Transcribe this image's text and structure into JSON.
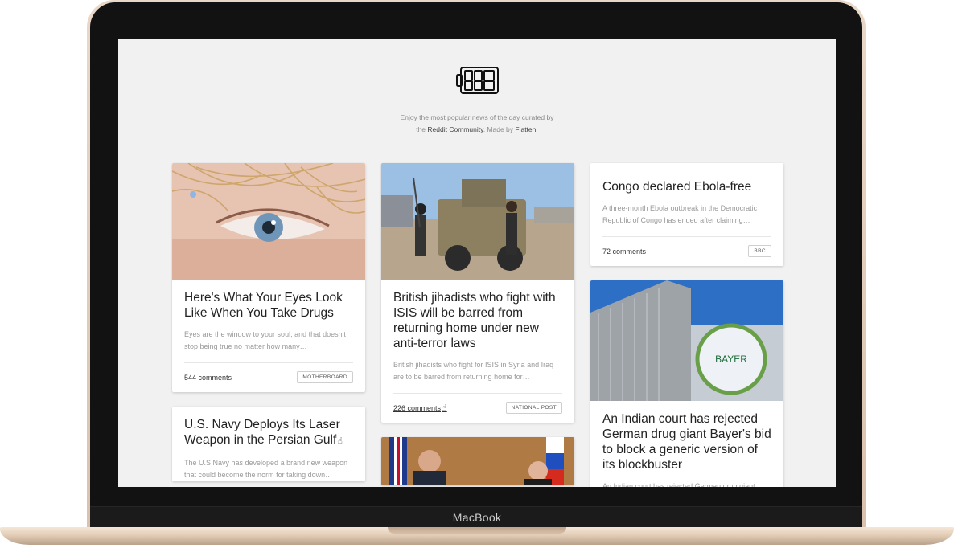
{
  "device": {
    "label": "MacBook"
  },
  "site": {
    "logo_icon": "tile-grid-logo-icon",
    "tagline": {
      "line1": "Enjoy the most popular news of the day curated by",
      "pre": "the ",
      "community": "Reddit Community",
      "mid": ". Made by ",
      "maker": "Flatten",
      "post": "."
    }
  },
  "cards": {
    "eyes": {
      "title": "Here's What Your Eyes Look Like When You Take Drugs",
      "excerpt": "Eyes are the window to your soul, and that doesn't stop being true no matter how many…",
      "comments": "544 comments",
      "source": "MOTHERBOARD"
    },
    "navy": {
      "title": "U.S. Navy Deploys Its Laser Weapon in the Persian Gulf",
      "excerpt": "The U.S Navy has developed a brand new weapon that could become the norm for taking down…"
    },
    "isis": {
      "title": "British jihadists who fight with ISIS will be barred from returning home under new anti-terror laws",
      "excerpt": "British jihadists who fight for ISIS in Syria and Iraq are to be barred from returning home for…",
      "comments": "226 comments",
      "source": "NATIONAL POST"
    },
    "ebola": {
      "title": "Congo declared Ebola-free",
      "excerpt": "A three-month Ebola outbreak in the Democratic Republic of Congo has ended after claiming…",
      "comments": "72 comments",
      "source": "BBC"
    },
    "bayer": {
      "title": "An Indian court has rejected German drug giant Bayer's bid to block a generic version of its blockbuster",
      "excerpt": "An Indian court has rejected German drug giant…",
      "sign": "BAYER"
    }
  }
}
